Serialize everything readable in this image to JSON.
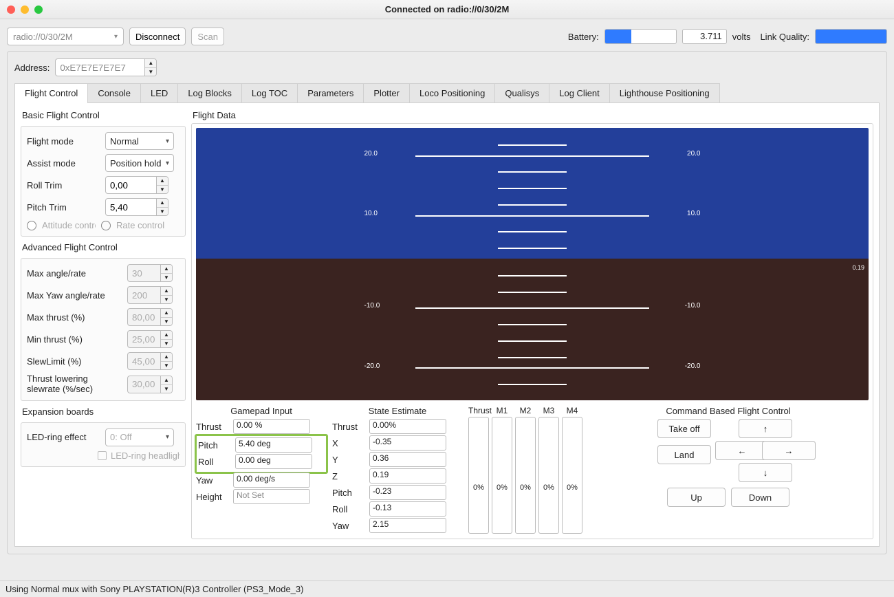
{
  "window": {
    "title": "Connected on radio://0/30/2M"
  },
  "toolbar": {
    "uri": "radio://0/30/2M",
    "disconnect": "Disconnect",
    "scan": "Scan",
    "battery_label": "Battery:",
    "battery_pct": 37,
    "volts": "3.711",
    "volts_unit": "volts",
    "lq_label": "Link Quality:"
  },
  "address": {
    "label": "Address:",
    "value": "0xE7E7E7E7E7"
  },
  "tabs": [
    "Flight Control",
    "Console",
    "LED",
    "Log Blocks",
    "Log TOC",
    "Parameters",
    "Plotter",
    "Loco Positioning",
    "Qualisys",
    "Log Client",
    "Lighthouse Positioning"
  ],
  "active_tab": 0,
  "basic": {
    "title": "Basic Flight Control",
    "flight_mode_lbl": "Flight mode",
    "flight_mode": "Normal",
    "assist_mode_lbl": "Assist mode",
    "assist_mode": "Position hold",
    "roll_trim_lbl": "Roll Trim",
    "roll_trim": "0,00",
    "pitch_trim_lbl": "Pitch Trim",
    "pitch_trim": "5,40",
    "attitude_lbl": "Attitude control",
    "rate_lbl": "Rate control"
  },
  "advanced": {
    "title": "Advanced Flight Control",
    "max_angle_lbl": "Max angle/rate",
    "max_angle": "30",
    "max_yaw_lbl": "Max Yaw angle/rate",
    "max_yaw": "200",
    "max_thrust_lbl": "Max thrust (%)",
    "max_thrust": "80,00",
    "min_thrust_lbl": "Min thrust (%)",
    "min_thrust": "25,00",
    "slew_lbl": "SlewLimit (%)",
    "slew": "45,00",
    "tlsr_lbl": "Thrust lowering slewrate (%/sec)",
    "tlsr": "30,00"
  },
  "expansion": {
    "title": "Expansion boards",
    "led_lbl": "LED-ring effect",
    "led_val": "0: Off",
    "led_head_lbl": "LED-ring headlight"
  },
  "flight_data": {
    "title": "Flight Data",
    "hud_labels": {
      "p20": "20.0",
      "p10": "10.0",
      "m10": "-10.0",
      "m20": "-20.0"
    },
    "hud_small": "0.19"
  },
  "gamepad": {
    "title": "Gamepad Input",
    "thrust_lbl": "Thrust",
    "thrust": "0.00 %",
    "pitch_lbl": "Pitch",
    "pitch": "5.40 deg",
    "roll_lbl": "Roll",
    "roll": "0.00 deg",
    "yaw_lbl": "Yaw",
    "yaw": "0.00 deg/s",
    "height_lbl": "Height",
    "height": "Not Set"
  },
  "state": {
    "title": "State Estimate",
    "thrust_lbl": "Thrust",
    "thrust": "0.00%",
    "x_lbl": "X",
    "x": "-0.35",
    "y_lbl": "Y",
    "y": "0.36",
    "z_lbl": "Z",
    "z": "0.19",
    "pitch_lbl": "Pitch",
    "pitch": "-0.23",
    "roll_lbl": "Roll",
    "roll": "-0.13",
    "yaw_lbl": "Yaw",
    "yaw": "2.15"
  },
  "motors": {
    "headers": [
      "Thrust",
      "M1",
      "M2",
      "M3",
      "M4"
    ],
    "values": [
      "0%",
      "0%",
      "0%",
      "0%",
      "0%"
    ]
  },
  "cmd": {
    "title": "Command Based Flight Control",
    "takeoff": "Take off",
    "land": "Land",
    "up": "Up",
    "down": "Down",
    "arrow_up": "↑",
    "arrow_down": "↓",
    "arrow_left": "←",
    "arrow_right": "→"
  },
  "statusbar": "Using Normal mux with Sony PLAYSTATION(R)3 Controller (PS3_Mode_3)"
}
